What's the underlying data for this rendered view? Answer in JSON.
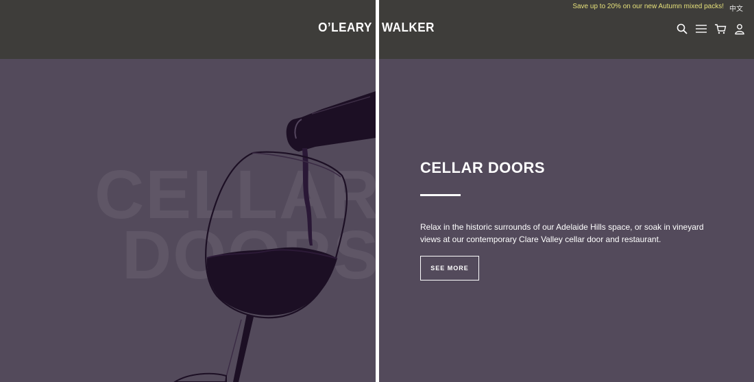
{
  "header": {
    "promo_text": "Save up to 20% on our new Autumn mixed packs!",
    "language_label": "中文",
    "logo_left": "O’LEARY",
    "logo_right": "WALKER",
    "icons": [
      "search-icon",
      "menu-icon",
      "cart-icon",
      "account-icon"
    ]
  },
  "hero": {
    "background_text_line1": "CELLAR",
    "background_text_line2": "DOORS",
    "title": "CELLAR DOORS",
    "description": "Relax in the historic surrounds of our Adelaide Hills space, or soak in vineyard views at our contemporary Clare Valley cellar door and restaurant.",
    "cta_label": "SEE MORE"
  },
  "colors": {
    "header_bg": "#3e3d3a",
    "hero_bg": "#534a5b",
    "promo_text": "#e5e07a",
    "wine": "#1c0f24",
    "text": "#ffffff"
  }
}
